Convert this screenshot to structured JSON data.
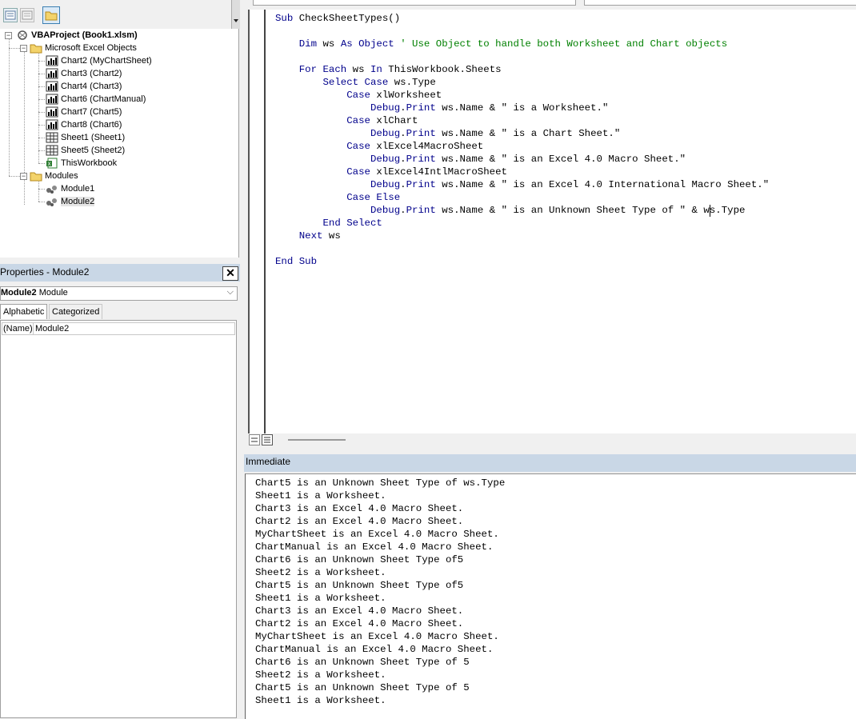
{
  "project": {
    "root": "VBAProject (Book1.xlsm)",
    "folders": [
      {
        "label": "Microsoft Excel Objects"
      },
      {
        "label": "Modules"
      }
    ],
    "excel_objects": [
      {
        "label": "Chart2 (MyChartSheet)",
        "kind": "chart"
      },
      {
        "label": "Chart3 (Chart2)",
        "kind": "chart"
      },
      {
        "label": "Chart4 (Chart3)",
        "kind": "chart"
      },
      {
        "label": "Chart6 (ChartManual)",
        "kind": "chart"
      },
      {
        "label": "Chart7 (Chart5)",
        "kind": "chart"
      },
      {
        "label": "Chart8 (Chart6)",
        "kind": "chart"
      },
      {
        "label": "Sheet1 (Sheet1)",
        "kind": "sheet"
      },
      {
        "label": "Sheet5 (Sheet2)",
        "kind": "sheet"
      },
      {
        "label": "ThisWorkbook",
        "kind": "workbook"
      }
    ],
    "modules": [
      {
        "label": "Module1"
      },
      {
        "label": "Module2"
      }
    ]
  },
  "properties": {
    "title": "Properties - Module2",
    "object_name": "Module2",
    "object_type": "Module",
    "tabs": [
      "Alphabetic",
      "Categorized"
    ],
    "rows": [
      {
        "name": "(Name)",
        "value": "Module2"
      }
    ]
  },
  "code": {
    "lines": [
      {
        "segs": [
          {
            "t": "Sub ",
            "c": "kw"
          },
          {
            "t": "CheckSheetTypes()",
            "c": ""
          }
        ]
      },
      {
        "segs": []
      },
      {
        "segs": [
          {
            "t": "    Dim ",
            "c": "kw"
          },
          {
            "t": "ws ",
            "c": ""
          },
          {
            "t": "As ",
            "c": "kw"
          },
          {
            "t": "Object ",
            "c": "kw"
          },
          {
            "t": "' Use Object to handle both Worksheet and Chart objects",
            "c": "cm"
          }
        ]
      },
      {
        "segs": []
      },
      {
        "segs": [
          {
            "t": "    For Each ",
            "c": "kw"
          },
          {
            "t": "ws ",
            "c": ""
          },
          {
            "t": "In ",
            "c": "kw"
          },
          {
            "t": "ThisWorkbook.Sheets",
            "c": ""
          }
        ]
      },
      {
        "segs": [
          {
            "t": "        Select Case ",
            "c": "kw"
          },
          {
            "t": "ws.Type",
            "c": ""
          }
        ]
      },
      {
        "segs": [
          {
            "t": "            Case ",
            "c": "kw"
          },
          {
            "t": "xlWorksheet",
            "c": ""
          }
        ]
      },
      {
        "segs": [
          {
            "t": "                Debug",
            "c": "kw"
          },
          {
            "t": ".",
            "c": ""
          },
          {
            "t": "Print ",
            "c": "kw"
          },
          {
            "t": "ws.Name & \" is a Worksheet.\"",
            "c": ""
          }
        ]
      },
      {
        "segs": [
          {
            "t": "            Case ",
            "c": "kw"
          },
          {
            "t": "xlChart",
            "c": ""
          }
        ]
      },
      {
        "segs": [
          {
            "t": "                Debug",
            "c": "kw"
          },
          {
            "t": ".",
            "c": ""
          },
          {
            "t": "Print ",
            "c": "kw"
          },
          {
            "t": "ws.Name & \" is a Chart Sheet.\"",
            "c": ""
          }
        ]
      },
      {
        "segs": [
          {
            "t": "            Case ",
            "c": "kw"
          },
          {
            "t": "xlExcel4MacroSheet",
            "c": ""
          }
        ]
      },
      {
        "segs": [
          {
            "t": "                Debug",
            "c": "kw"
          },
          {
            "t": ".",
            "c": ""
          },
          {
            "t": "Print ",
            "c": "kw"
          },
          {
            "t": "ws.Name & \" is an Excel 4.0 Macro Sheet.\"",
            "c": ""
          }
        ]
      },
      {
        "segs": [
          {
            "t": "            Case ",
            "c": "kw"
          },
          {
            "t": "xlExcel4IntlMacroSheet",
            "c": ""
          }
        ]
      },
      {
        "segs": [
          {
            "t": "                Debug",
            "c": "kw"
          },
          {
            "t": ".",
            "c": ""
          },
          {
            "t": "Print ",
            "c": "kw"
          },
          {
            "t": "ws.Name & \" is an Excel 4.0 International Macro Sheet.\"",
            "c": ""
          }
        ]
      },
      {
        "segs": [
          {
            "t": "            Case Else",
            "c": "kw"
          }
        ]
      },
      {
        "segs": [
          {
            "t": "                Debug",
            "c": "kw"
          },
          {
            "t": ".",
            "c": ""
          },
          {
            "t": "Print ",
            "c": "kw"
          },
          {
            "t": "ws.Name & \" is an Unknown Sheet Type of \" & ws.Type",
            "c": ""
          }
        ]
      },
      {
        "segs": [
          {
            "t": "        End Select",
            "c": "kw"
          }
        ]
      },
      {
        "segs": [
          {
            "t": "    Next ",
            "c": "kw"
          },
          {
            "t": "ws",
            "c": ""
          }
        ]
      },
      {
        "segs": []
      },
      {
        "segs": [
          {
            "t": "End Sub",
            "c": "kw"
          }
        ]
      }
    ]
  },
  "immediate": {
    "title": "Immediate",
    "lines": [
      "Chart5 is an Unknown Sheet Type of ws.Type",
      "Sheet1 is a Worksheet.",
      "Chart3 is an Excel 4.0 Macro Sheet.",
      "Chart2 is an Excel 4.0 Macro Sheet.",
      "MyChartSheet is an Excel 4.0 Macro Sheet.",
      "ChartManual is an Excel 4.0 Macro Sheet.",
      "Chart6 is an Unknown Sheet Type of5",
      "Sheet2 is a Worksheet.",
      "Chart5 is an Unknown Sheet Type of5",
      "Sheet1 is a Worksheet.",
      "Chart3 is an Excel 4.0 Macro Sheet.",
      "Chart2 is an Excel 4.0 Macro Sheet.",
      "MyChartSheet is an Excel 4.0 Macro Sheet.",
      "ChartManual is an Excel 4.0 Macro Sheet.",
      "Chart6 is an Unknown Sheet Type of 5",
      "Sheet2 is a Worksheet.",
      "Chart5 is an Unknown Sheet Type of 5",
      "Sheet1 is a Worksheet."
    ]
  },
  "colors": {
    "keyword": "#00008b",
    "comment": "#008000",
    "title_bar": "#c9d7e6"
  }
}
